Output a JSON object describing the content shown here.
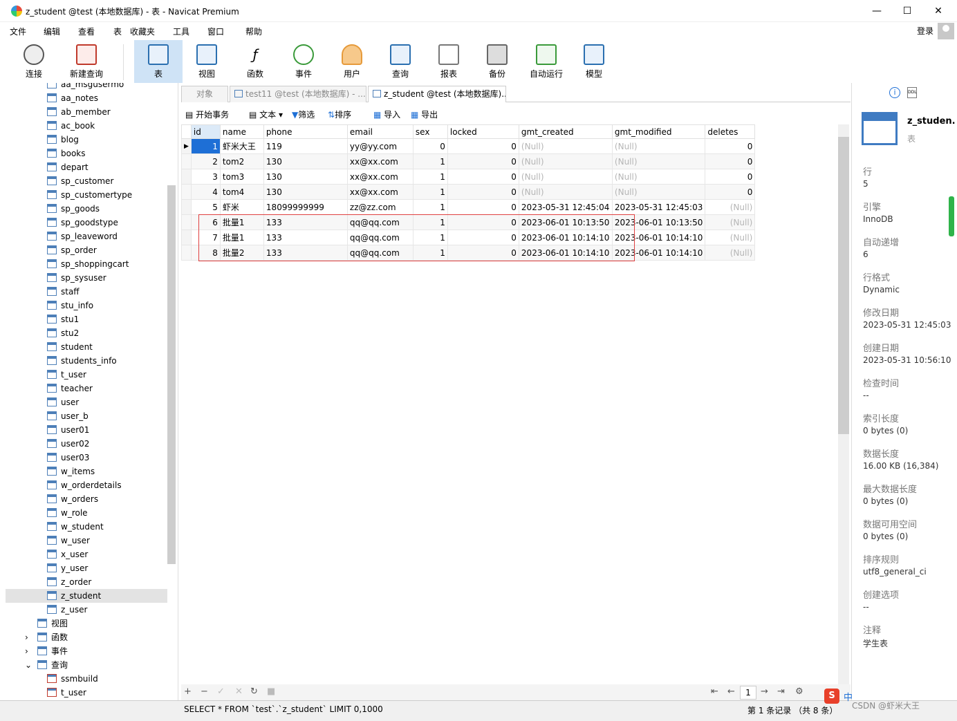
{
  "window": {
    "title": "z_student @test (本地数据库) - 表 - Navicat Premium",
    "minimize": "—",
    "maximize": "☐",
    "close": "✕"
  },
  "menu": [
    "文件",
    "编辑",
    "查看",
    "表",
    "收藏夹",
    "工具",
    "窗口",
    "帮助"
  ],
  "login": "登录",
  "toolbar": {
    "connect": "连接",
    "new_query": "新建查询",
    "table": "表",
    "view": "视图",
    "function": "函数",
    "event": "事件",
    "user": "用户",
    "query": "查询",
    "report": "报表",
    "backup": "备份",
    "autorun": "自动运行",
    "model": "模型"
  },
  "tree": {
    "tables": [
      "aa_msgusermo",
      "aa_notes",
      "ab_member",
      "ac_book",
      "blog",
      "books",
      "depart",
      "sp_customer",
      "sp_customertype",
      "sp_goods",
      "sp_goodstype",
      "sp_leaveword",
      "sp_order",
      "sp_shoppingcart",
      "sp_sysuser",
      "staff",
      "stu_info",
      "stu1",
      "stu2",
      "student",
      "students_info",
      "t_user",
      "teacher",
      "user",
      "user_b",
      "user01",
      "user02",
      "user03",
      "w_items",
      "w_orderdetails",
      "w_orders",
      "w_role",
      "w_student",
      "w_user",
      "x_user",
      "y_user",
      "z_order",
      "z_student",
      "z_user"
    ],
    "views": "视图",
    "functions": "函数",
    "events": "事件",
    "queries": "查询",
    "query_items": [
      "ssmbuild",
      "t_user"
    ]
  },
  "tabs": {
    "objects": "对象",
    "tab1": "test11 @test (本地数据库) - ...",
    "tab2": "z_student @test (本地数据库)..."
  },
  "gridtool": {
    "begin_tx": "开始事务",
    "text": "文本",
    "filter": "筛选",
    "sort": "排序",
    "import": "导入",
    "export": "导出"
  },
  "grid": {
    "columns": [
      "id",
      "name",
      "phone",
      "email",
      "sex",
      "locked",
      "gmt_created",
      "gmt_modified",
      "deletes"
    ],
    "rows": [
      [
        "1",
        "虾米大王",
        "119",
        "yy@yy.com",
        "0",
        "0",
        "(Null)",
        "(Null)",
        "0"
      ],
      [
        "2",
        "tom2",
        "130",
        "xx@xx.com",
        "1",
        "0",
        "(Null)",
        "(Null)",
        "0"
      ],
      [
        "3",
        "tom3",
        "130",
        "xx@xx.com",
        "1",
        "0",
        "(Null)",
        "(Null)",
        "0"
      ],
      [
        "4",
        "tom4",
        "130",
        "xx@xx.com",
        "1",
        "0",
        "(Null)",
        "(Null)",
        "0"
      ],
      [
        "5",
        "虾米",
        "18099999999",
        "zz@zz.com",
        "1",
        "0",
        "2023-05-31 12:45:04",
        "2023-05-31 12:45:03",
        "(Null)"
      ],
      [
        "6",
        "批量1",
        "133",
        "qq@qq.com",
        "1",
        "0",
        "2023-06-01 10:13:50",
        "2023-06-01 10:13:50",
        "(Null)"
      ],
      [
        "7",
        "批量1",
        "133",
        "qq@qq.com",
        "1",
        "0",
        "2023-06-01 10:14:10",
        "2023-06-01 10:14:10",
        "(Null)"
      ],
      [
        "8",
        "批量2",
        "133",
        "qq@qq.com",
        "1",
        "0",
        "2023-06-01 10:14:10",
        "2023-06-01 10:14:10",
        "(Null)"
      ]
    ]
  },
  "pager": {
    "page": "1"
  },
  "status": {
    "sql": "SELECT * FROM `test`.`z_student` LIMIT 0,1000",
    "records": "第 1 条记录 （共 8 条）"
  },
  "info": {
    "name": "z_studen.",
    "type": "表",
    "fields": [
      {
        "label": "行",
        "value": "5"
      },
      {
        "label": "引擎",
        "value": "InnoDB"
      },
      {
        "label": "自动递增",
        "value": "6"
      },
      {
        "label": "行格式",
        "value": "Dynamic"
      },
      {
        "label": "修改日期",
        "value": "2023-05-31 12:45:03"
      },
      {
        "label": "创建日期",
        "value": "2023-05-31 10:56:10"
      },
      {
        "label": "检查时间",
        "value": "--"
      },
      {
        "label": "索引长度",
        "value": "0 bytes (0)"
      },
      {
        "label": "数据长度",
        "value": "16.00 KB (16,384)"
      },
      {
        "label": "最大数据长度",
        "value": "0 bytes (0)"
      },
      {
        "label": "数据可用空间",
        "value": "0 bytes (0)"
      },
      {
        "label": "排序规则",
        "value": "utf8_general_ci"
      },
      {
        "label": "创建选项",
        "value": "--"
      },
      {
        "label": "注释",
        "value": "学生表"
      }
    ]
  },
  "watermark": "CSDN @虾米大王",
  "ime": "中"
}
